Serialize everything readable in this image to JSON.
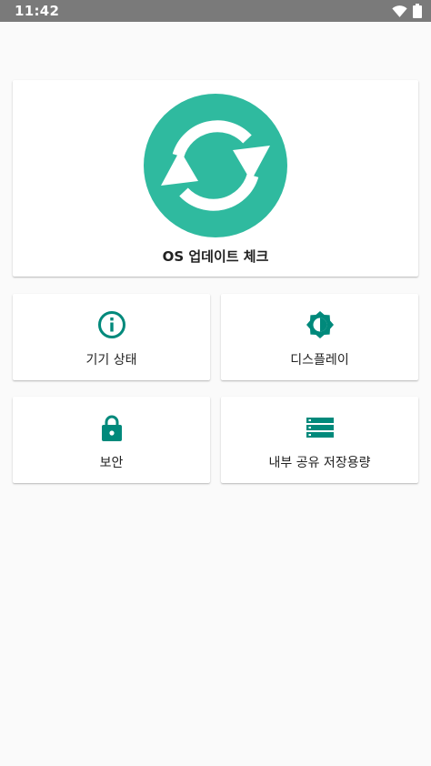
{
  "status_bar": {
    "time": "11:42",
    "icons": [
      "wifi-icon",
      "battery-icon"
    ]
  },
  "colors": {
    "accent": "#2fba9f",
    "icon_teal": "#00897b",
    "status_bar": "#7a7a7a",
    "background": "#fafafa"
  },
  "update_card": {
    "label": "OS 업데이트 체크",
    "icon": "sync-icon"
  },
  "tiles": [
    {
      "label": "기기 상태",
      "icon": "info-icon"
    },
    {
      "label": "디스플레이",
      "icon": "brightness-icon"
    },
    {
      "label": "보안",
      "icon": "lock-icon"
    },
    {
      "label": "내부 공유 저장용량",
      "icon": "storage-icon"
    }
  ]
}
